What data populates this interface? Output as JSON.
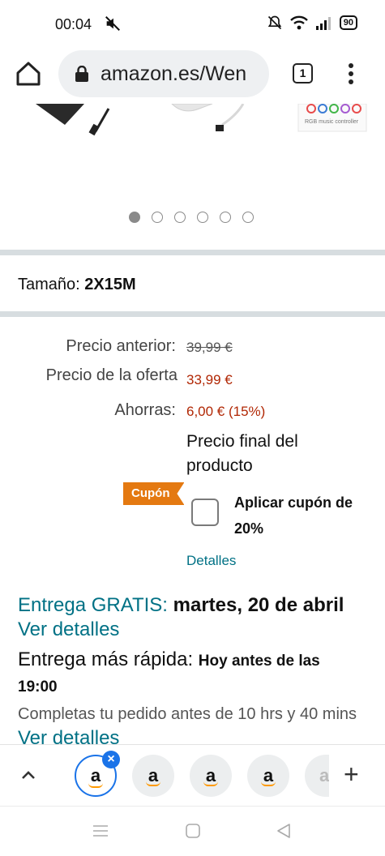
{
  "status_bar": {
    "time": "00:04",
    "battery": "90"
  },
  "browser": {
    "url": "amazon.es/Wen",
    "tab_count": "1"
  },
  "product_image": {
    "label_text": "RGB music controller",
    "carousel_total": 6,
    "carousel_active": 1
  },
  "size": {
    "label": "Tamaño:",
    "value": "2X15M"
  },
  "pricing": {
    "previous_label": "Precio anterior:",
    "previous_value": "39,99 €",
    "offer_label": "Precio de la oferta",
    "offer_value": "33,99 €",
    "savings_label": "Ahorras:",
    "savings_value": "6,00 € (15%)",
    "final_note": "Precio final del producto"
  },
  "coupon": {
    "badge": "Cupón",
    "text": "Aplicar cupón de 20%",
    "details_link": "Detalles"
  },
  "delivery": {
    "free_label": "Entrega GRATIS:",
    "free_date": "martes, 20 de abril",
    "free_link": "Ver detalles",
    "fast_label": "Entrega más rápida:",
    "fast_when": "Hoy antes de las",
    "fast_time": "19:00",
    "order_text": "Completas tu pedido antes de 10 hrs y 40 mins",
    "order_link": "Ver detalles"
  },
  "tab_strip": {
    "tab_glyph": "a"
  },
  "colors": {
    "accent_teal": "#007185",
    "price_red": "#b12704",
    "coupon_orange": "#e47911",
    "tab_blue": "#1a73e8"
  }
}
